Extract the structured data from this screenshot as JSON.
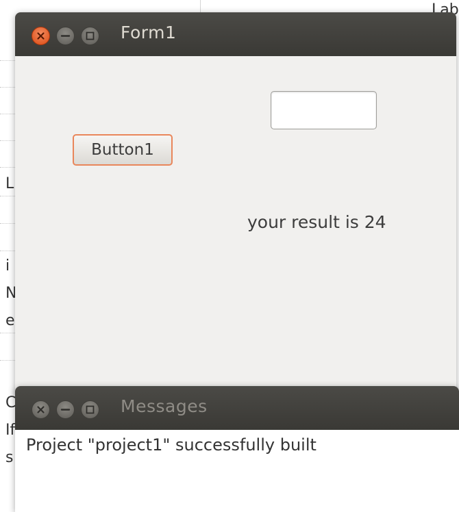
{
  "background": {
    "fragments": {
      "top_right": "Lab",
      "f1": "L",
      "f2": "i",
      "f3": "N",
      "f4": "e",
      "f5": "C",
      "f6": "If",
      "f7": "s"
    }
  },
  "form_window": {
    "title": "Form1",
    "buttons": {
      "close": "close-icon",
      "minimize": "minimize-icon",
      "maximize": "maximize-icon"
    },
    "edit_value": "",
    "button_label": "Button1",
    "result_label": "your result is 24"
  },
  "messages_window": {
    "title": "Messages",
    "messages": [
      "Project \"project1\" successfully built"
    ]
  },
  "colors": {
    "titlebar": "#3f3e3a",
    "close_active": "#e8622a",
    "window_bg": "#f1f0ee",
    "focus_border": "#e9865a"
  }
}
